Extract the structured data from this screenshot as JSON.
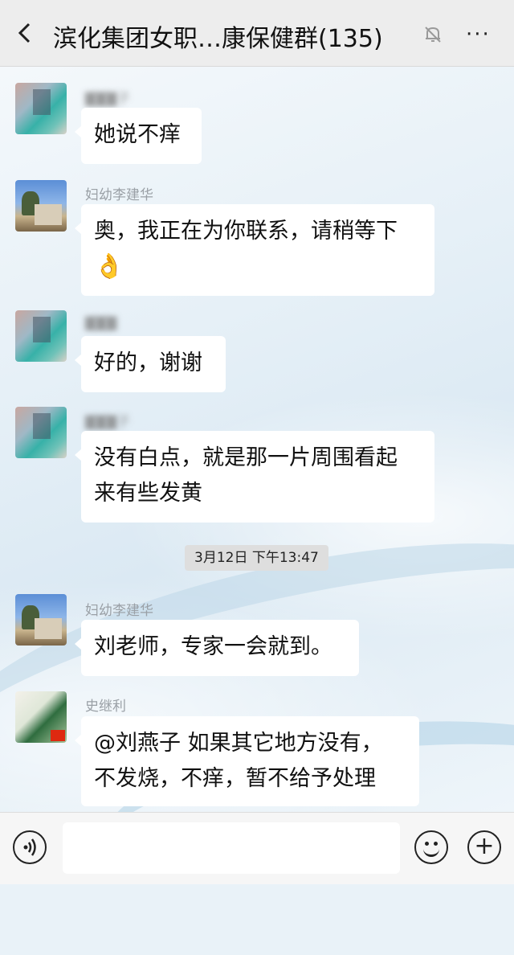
{
  "header": {
    "back_icon": "chevron-left-icon",
    "title": "滨化集团女职…康保健群(135)",
    "mute_icon": "bell-off-icon",
    "more_label": "···"
  },
  "messages": [
    {
      "sender": "",
      "text_lines": [
        "她说不痒"
      ],
      "avatar": "blurred-avatar"
    },
    {
      "sender": "妇幼李建华",
      "text_lines": [
        "奥，我正在为你联系，请稍等下"
      ],
      "emoji": "👌",
      "avatar": "photo-avatar"
    },
    {
      "sender": "",
      "text_lines": [
        "好的，谢谢"
      ],
      "avatar": "blurred-avatar"
    },
    {
      "sender": "",
      "text_lines": [
        "没有白点，就是那一片周围看起",
        "来有些发黄"
      ],
      "avatar": "blurred-avatar"
    },
    {
      "sender": "妇幼李建华",
      "text_lines": [
        "刘老师，专家一会就到。"
      ],
      "avatar": "photo-avatar"
    },
    {
      "sender": "史继利",
      "text_lines": [
        "@刘燕子  如果其它地方没有，",
        "不发烧，不痒，暂不给予处理"
      ],
      "avatar": "green-avatar"
    }
  ],
  "timestamp": "3月12日 下午13:47",
  "input_bar": {
    "voice_icon": "voice-icon",
    "input_value": "",
    "emoji_icon": "smile-icon",
    "plus_icon": "plus-icon"
  }
}
